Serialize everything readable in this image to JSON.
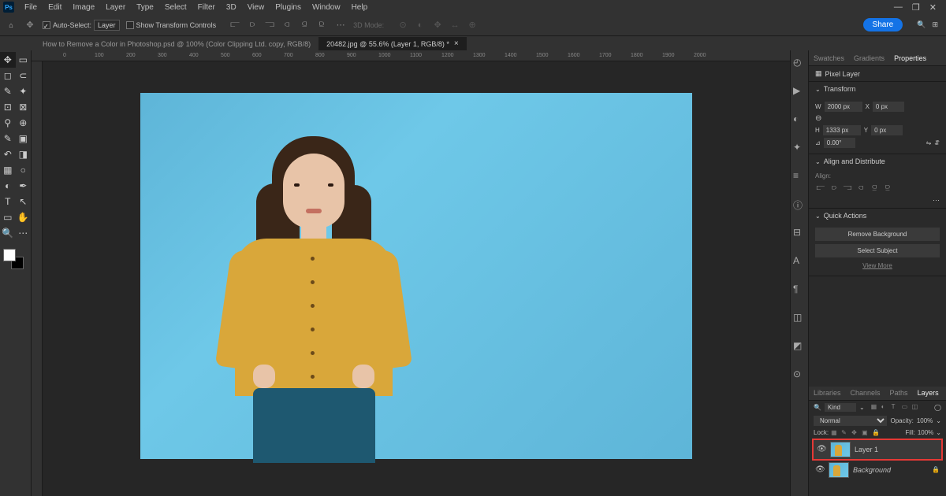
{
  "app_logo": "Ps",
  "menu": [
    "File",
    "Edit",
    "Image",
    "Layer",
    "Type",
    "Select",
    "Filter",
    "3D",
    "View",
    "Plugins",
    "Window",
    "Help"
  ],
  "options": {
    "auto_select": "Auto-Select:",
    "layer_mode": "Layer",
    "show_transform": "Show Transform Controls",
    "three_d": "3D Mode:",
    "share": "Share"
  },
  "tabs": [
    {
      "title": "How to Remove a Color in Photoshop.psd @ 100% (Color Clipping Ltd. copy, RGB/8)"
    },
    {
      "title": "20482.jpg @ 55.6% (Layer 1, RGB/8) *"
    }
  ],
  "ruler_marks": [
    "0",
    "100",
    "200",
    "300",
    "400",
    "500",
    "600",
    "700",
    "800",
    "900",
    "1000",
    "1100",
    "1200",
    "1300",
    "1400",
    "1500",
    "1600",
    "1700",
    "1800",
    "1900",
    "2000"
  ],
  "properties": {
    "tab_swatches": "Swatches",
    "tab_gradients": "Gradients",
    "tab_properties": "Properties",
    "pixel_layer": "Pixel Layer",
    "transform_label": "Transform",
    "w": "W",
    "w_val": "2000 px",
    "x": "X",
    "x_val": "0 px",
    "h": "H",
    "h_val": "1333 px",
    "y": "Y",
    "y_val": "0 px",
    "angle": "0.00°",
    "align_distribute": "Align and Distribute",
    "align_label": "Align:",
    "quick_actions": "Quick Actions",
    "remove_bg": "Remove Background",
    "select_subject": "Select Subject",
    "view_more": "View More"
  },
  "layers_panel": {
    "tab_libraries": "Libraries",
    "tab_channels": "Channels",
    "tab_paths": "Paths",
    "tab_layers": "Layers",
    "kind": "Kind",
    "blend_mode": "Normal",
    "opacity_label": "Opacity:",
    "opacity_val": "100%",
    "lock_label": "Lock:",
    "fill_label": "Fill:",
    "fill_val": "100%",
    "layers": [
      {
        "name": "Layer 1",
        "highlighted": true,
        "locked": false
      },
      {
        "name": "Background",
        "highlighted": false,
        "locked": true
      }
    ]
  }
}
